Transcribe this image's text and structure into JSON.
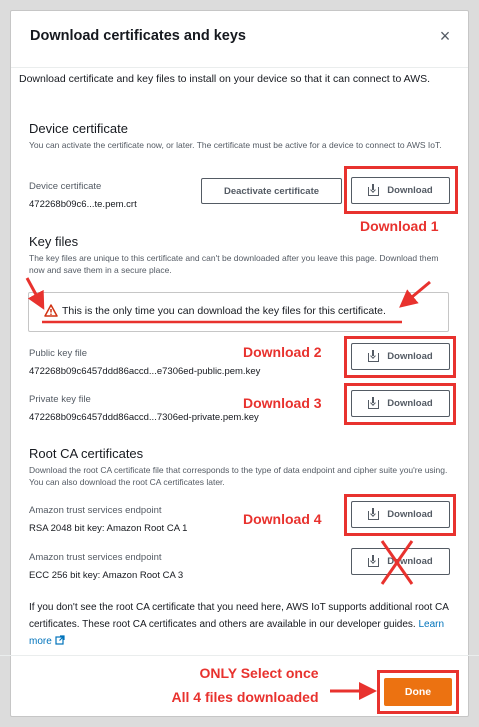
{
  "modal": {
    "title": "Download certificates and keys",
    "close_symbol": "×",
    "intro": "Download certificate and key files to install on your device so that it can connect to AWS."
  },
  "device_certificate": {
    "heading": "Device certificate",
    "description": "You can activate the certificate now, or later. The certificate must be active for a device to connect to AWS IoT.",
    "label": "Device certificate",
    "filename": "472268b09c6...te.pem.crt",
    "deactivate_label": "Deactivate certificate",
    "download_label": "Download"
  },
  "key_files": {
    "heading": "Key files",
    "description": "The key files are unique to this certificate and can't be downloaded after you leave this page. Download them now and save them in a secure place.",
    "warning": "This is the only time you can download the key files for this certificate.",
    "public_label": "Public key file",
    "public_filename": "472268b09c6457ddd86accd...e7306ed-public.pem.key",
    "private_label": "Private key file",
    "private_filename": "472268b09c6457ddd86accd...7306ed-private.pem.key",
    "download_label": "Download"
  },
  "root_ca": {
    "heading": "Root CA certificates",
    "description": "Download the root CA certificate file that corresponds to the type of data endpoint and cipher suite you're using. You can also download the root CA certificates later.",
    "items": [
      {
        "label": "Amazon trust services endpoint",
        "value": "RSA 2048 bit key: Amazon Root CA 1",
        "download_label": "Download"
      },
      {
        "label": "Amazon trust services endpoint",
        "value": "ECC 256 bit key: Amazon Root CA 3",
        "download_label": "Download"
      }
    ],
    "note": "If you don't see the root CA certificate that you need here, AWS IoT supports additional root CA certificates. These root CA certificates and others are available in our developer guides.",
    "learn_more": "Learn more"
  },
  "annotations": {
    "download_1": "Download 1",
    "download_2": "Download 2",
    "download_3": "Download 3",
    "download_4": "Download 4",
    "only_line1": "ONLY Select once",
    "only_line2": "All 4 files downloaded"
  },
  "footer": {
    "done_label": "Done"
  },
  "colors": {
    "annotation_red": "#e8322e",
    "primary_orange": "#ec7211",
    "link_blue": "#0073bb",
    "warning_red": "#d13212"
  },
  "icons": [
    "close-icon",
    "download-icon",
    "warning-icon",
    "external-link-icon",
    "arrow-icon",
    "cross-out-icon"
  ]
}
